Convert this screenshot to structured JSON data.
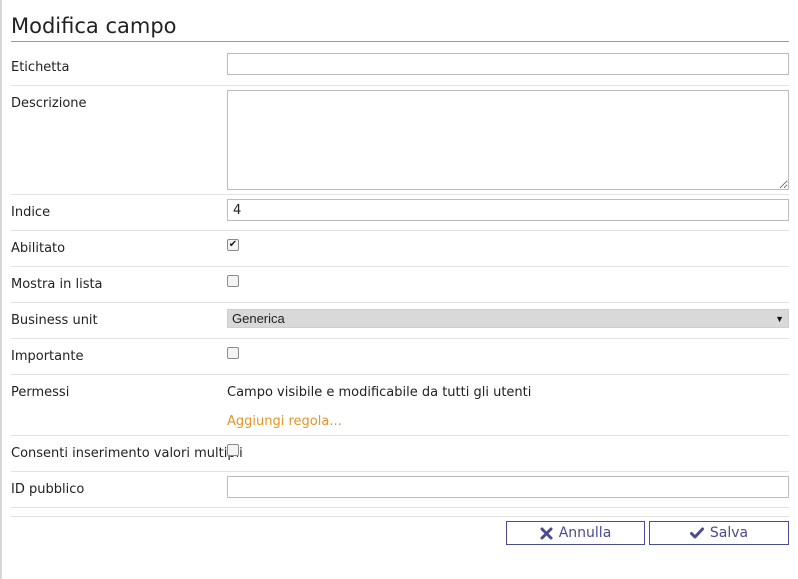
{
  "page": {
    "title": "Modifica campo"
  },
  "form": {
    "etichetta": {
      "label": "Etichetta",
      "value": ""
    },
    "descrizione": {
      "label": "Descrizione",
      "value": ""
    },
    "indice": {
      "label": "Indice",
      "value": "4"
    },
    "abilitato": {
      "label": "Abilitato",
      "checked": true,
      "check_glyph": "✔"
    },
    "mostra_in_lista": {
      "label": "Mostra in lista",
      "checked": false
    },
    "business_unit": {
      "label": "Business unit",
      "selected": "Generica",
      "arrow": "▼"
    },
    "importante": {
      "label": "Importante",
      "checked": false
    },
    "permessi": {
      "label": "Permessi",
      "text": "Campo visibile e modificabile da tutti gli utenti",
      "link": "Aggiungi regola..."
    },
    "valori_multipli": {
      "label": "Consenti inserimento valori multipli",
      "checked": false
    },
    "id_pubblico": {
      "label": "ID pubblico",
      "value": ""
    }
  },
  "actions": {
    "cancel_label": "Annulla",
    "save_label": "Salva",
    "cancel_icon": "times-icon",
    "save_icon": "check-icon"
  },
  "colors": {
    "link": "#e3952b",
    "button": "#4b4b8f"
  }
}
